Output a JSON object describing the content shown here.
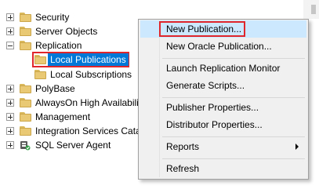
{
  "tree": {
    "items": [
      {
        "label": "Security",
        "expander": "plus"
      },
      {
        "label": "Server Objects",
        "expander": "plus"
      },
      {
        "label": "Replication",
        "expander": "minus"
      },
      {
        "label": "Local Publications",
        "selected": true
      },
      {
        "label": "Local Subscriptions"
      },
      {
        "label": "PolyBase",
        "expander": "plus"
      },
      {
        "label": "AlwaysOn High Availabili",
        "expander": "plus"
      },
      {
        "label": "Management",
        "expander": "plus"
      },
      {
        "label": "Integration Services Cata",
        "expander": "plus"
      },
      {
        "label": "SQL Server Agent",
        "expander": "plus"
      }
    ]
  },
  "context_menu": {
    "items": {
      "new_publication": "New Publication...",
      "new_oracle_publication": "New Oracle Publication...",
      "launch_replication_monitor": "Launch Replication Monitor",
      "generate_scripts": "Generate Scripts...",
      "publisher_properties": "Publisher Properties...",
      "distributor_properties": "Distributor Properties...",
      "reports": "Reports",
      "refresh": "Refresh"
    }
  },
  "colors": {
    "selection": "#0078d7",
    "highlight_outline": "#e0252b",
    "menu_hover": "#cce8ff",
    "menu_background": "#f0f0f0",
    "folder": "#e9c974"
  },
  "icons": {
    "folder": "folder-icon",
    "agent": "sql-server-agent-icon",
    "expand": "expand-plus-icon",
    "collapse": "collapse-minus-icon",
    "submenu": "submenu-arrow-icon"
  }
}
